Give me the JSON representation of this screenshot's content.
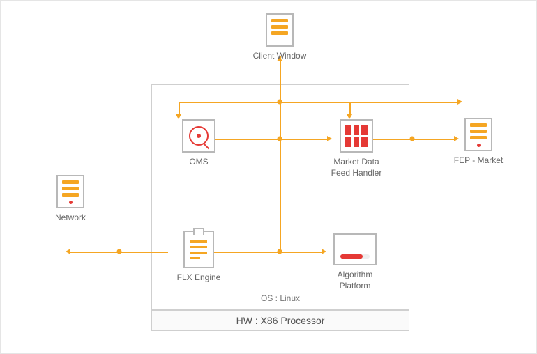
{
  "nodes": {
    "client_window": {
      "label": "Client Window"
    },
    "oms": {
      "label": "OMS"
    },
    "market_data": {
      "label": "Market Data\nFeed Handler"
    },
    "fep": {
      "label": "FEP - Market"
    },
    "network": {
      "label": "Network"
    },
    "flx": {
      "label": "FLX Engine"
    },
    "algorithm": {
      "label": "Algorithm\nPlatform"
    }
  },
  "container": {
    "os_label": "OS : Linux",
    "hw_label": "HW : X86 Processor"
  },
  "colors": {
    "accent": "#f5a623",
    "danger": "#e53935",
    "border": "#b8b8b8"
  }
}
